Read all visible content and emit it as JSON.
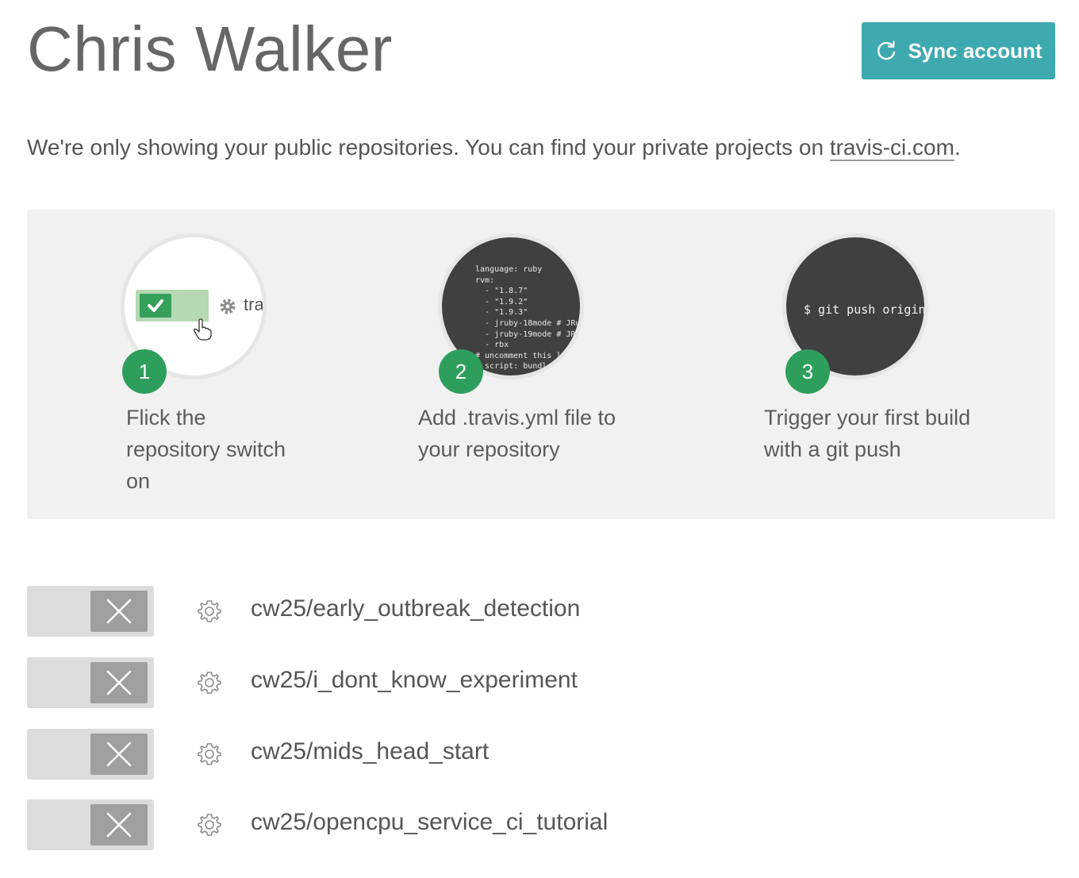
{
  "header": {
    "title": "Chris Walker",
    "sync_label": "Sync account",
    "sync_icon": "refresh-icon",
    "accent_color": "#3eaaaf"
  },
  "notice": {
    "text": "We're only showing your public repositories. You can find your private projects on ",
    "link_text": "travis-ci.com",
    "suffix": "."
  },
  "steps": [
    {
      "number": "1",
      "line1": "Flick the",
      "line2": "repository switch",
      "line3": "on",
      "preview_label": "tra"
    },
    {
      "number": "2",
      "line1": "Add .travis.yml file to",
      "line2": "your repository",
      "code": "language: ruby\nrvm:\n  - \"1.8.7\"\n  - \"1.9.2\"\n  - \"1.9.3\"\n  - jruby-18mode # JRuby\n  - jruby-19mode # JRuby\n  - rbx\n# uncomment this line\n# script: bundle"
    },
    {
      "number": "3",
      "line1": "Trigger your first build",
      "line2": "with a git push",
      "code": "$ git push origin"
    }
  ],
  "repos": [
    {
      "name": "cw25/early_outbreak_detection",
      "enabled": false
    },
    {
      "name": "cw25/i_dont_know_experiment",
      "enabled": false
    },
    {
      "name": "cw25/mids_head_start",
      "enabled": false
    },
    {
      "name": "cw25/opencpu_service_ci_tutorial",
      "enabled": false
    }
  ]
}
